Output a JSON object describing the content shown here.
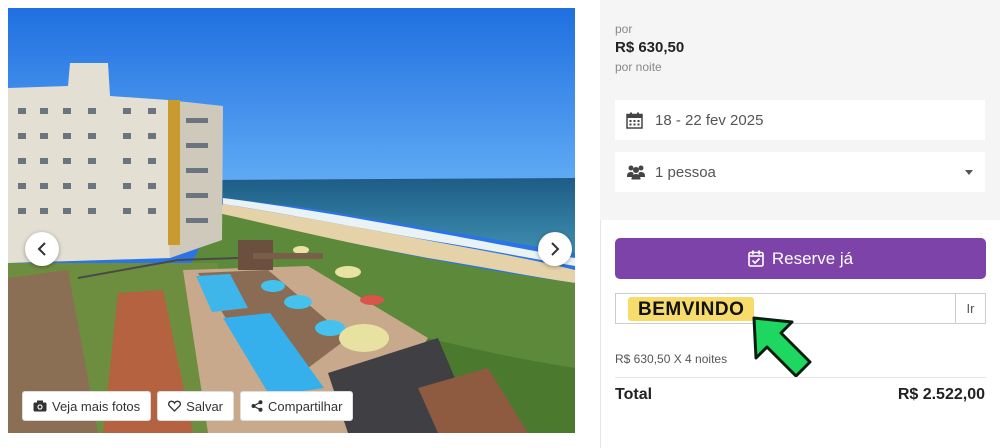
{
  "gallery": {
    "image_label": "",
    "actions": {
      "more_photos": "Veja mais fotos",
      "save": "Salvar",
      "share": "Compartilhar"
    },
    "icons": {
      "prev": "chevron-left-icon",
      "next": "chevron-right-icon",
      "camera": "camera-icon",
      "heart": "heart-icon",
      "share": "share-icon"
    }
  },
  "pricing": {
    "prefix": "por",
    "nightly_price": "R$ 630,50",
    "suffix": "por noite"
  },
  "booking": {
    "dates": "18 - 22 fev 2025",
    "guests": "1 pessoa",
    "reserve_label": "Reserve já",
    "coupon_value": "BEMVINDO",
    "coupon_apply_label": "Ir",
    "nights_breakdown": "R$ 630,50 X 4 noites",
    "total_label": "Total",
    "total_value": "R$ 2.522,00"
  },
  "colors": {
    "primary": "#7d43a8",
    "highlight": "#f7dc6b",
    "arrow": "#1ed760",
    "sidebar_bg": "#f5f5f5"
  }
}
